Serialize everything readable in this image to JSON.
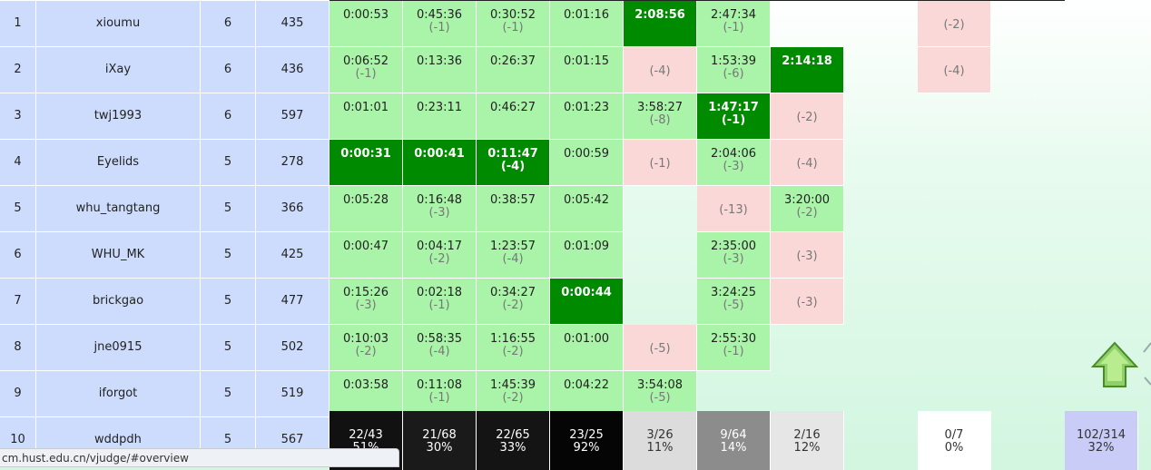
{
  "rows": [
    {
      "rank": "1",
      "name": "xioumu",
      "solved": "6",
      "penalty": "435",
      "cells": [
        {
          "s": "ac",
          "t": "0:00:53",
          "c": ""
        },
        {
          "s": "ac",
          "t": "0:45:36",
          "c": "(-1)"
        },
        {
          "s": "ac",
          "t": "0:30:52",
          "c": "(-1)"
        },
        {
          "s": "ac",
          "t": "0:01:16",
          "c": ""
        },
        {
          "s": "fb",
          "t": "2:08:56",
          "c": ""
        },
        {
          "s": "ac",
          "t": "2:47:34",
          "c": "(-1)"
        },
        {
          "s": "none",
          "t": "",
          "c": ""
        },
        {
          "s": "none",
          "t": "",
          "c": ""
        },
        {
          "s": "wa",
          "t": "",
          "c": "(-2)"
        }
      ]
    },
    {
      "rank": "2",
      "name": "iXay",
      "solved": "6",
      "penalty": "436",
      "cells": [
        {
          "s": "ac",
          "t": "0:06:52",
          "c": "(-1)"
        },
        {
          "s": "ac",
          "t": "0:13:36",
          "c": ""
        },
        {
          "s": "ac",
          "t": "0:26:37",
          "c": ""
        },
        {
          "s": "ac",
          "t": "0:01:15",
          "c": ""
        },
        {
          "s": "wa",
          "t": "",
          "c": "(-4)"
        },
        {
          "s": "ac",
          "t": "1:53:39",
          "c": "(-6)"
        },
        {
          "s": "fb",
          "t": "2:14:18",
          "c": ""
        },
        {
          "s": "none",
          "t": "",
          "c": ""
        },
        {
          "s": "wa",
          "t": "",
          "c": "(-4)"
        }
      ]
    },
    {
      "rank": "3",
      "name": "twj1993",
      "solved": "6",
      "penalty": "597",
      "cells": [
        {
          "s": "ac",
          "t": "0:01:01",
          "c": ""
        },
        {
          "s": "ac",
          "t": "0:23:11",
          "c": ""
        },
        {
          "s": "ac",
          "t": "0:46:27",
          "c": ""
        },
        {
          "s": "ac",
          "t": "0:01:23",
          "c": ""
        },
        {
          "s": "ac",
          "t": "3:58:27",
          "c": "(-8)"
        },
        {
          "s": "fb",
          "t": "1:47:17",
          "c": "(-1)"
        },
        {
          "s": "wa",
          "t": "",
          "c": "(-2)"
        },
        {
          "s": "none",
          "t": "",
          "c": ""
        },
        {
          "s": "none",
          "t": "",
          "c": ""
        }
      ]
    },
    {
      "rank": "4",
      "name": "Eyelids",
      "solved": "5",
      "penalty": "278",
      "cells": [
        {
          "s": "fb",
          "t": "0:00:31",
          "c": ""
        },
        {
          "s": "fb",
          "t": "0:00:41",
          "c": ""
        },
        {
          "s": "fb",
          "t": "0:11:47",
          "c": "(-4)"
        },
        {
          "s": "ac",
          "t": "0:00:59",
          "c": ""
        },
        {
          "s": "wa",
          "t": "",
          "c": "(-1)"
        },
        {
          "s": "ac",
          "t": "2:04:06",
          "c": "(-3)"
        },
        {
          "s": "wa",
          "t": "",
          "c": "(-4)"
        },
        {
          "s": "none",
          "t": "",
          "c": ""
        },
        {
          "s": "none",
          "t": "",
          "c": ""
        }
      ]
    },
    {
      "rank": "5",
      "name": "whu_tangtang",
      "solved": "5",
      "penalty": "366",
      "cells": [
        {
          "s": "ac",
          "t": "0:05:28",
          "c": ""
        },
        {
          "s": "ac",
          "t": "0:16:48",
          "c": "(-3)"
        },
        {
          "s": "ac",
          "t": "0:38:57",
          "c": ""
        },
        {
          "s": "ac",
          "t": "0:05:42",
          "c": ""
        },
        {
          "s": "none",
          "t": "",
          "c": ""
        },
        {
          "s": "wa",
          "t": "",
          "c": "(-13)"
        },
        {
          "s": "ac",
          "t": "3:20:00",
          "c": "(-2)"
        },
        {
          "s": "none",
          "t": "",
          "c": ""
        },
        {
          "s": "none",
          "t": "",
          "c": ""
        }
      ]
    },
    {
      "rank": "6",
      "name": "WHU_MK",
      "solved": "5",
      "penalty": "425",
      "cells": [
        {
          "s": "ac",
          "t": "0:00:47",
          "c": ""
        },
        {
          "s": "ac",
          "t": "0:04:17",
          "c": "(-2)"
        },
        {
          "s": "ac",
          "t": "1:23:57",
          "c": "(-4)"
        },
        {
          "s": "ac",
          "t": "0:01:09",
          "c": ""
        },
        {
          "s": "none",
          "t": "",
          "c": ""
        },
        {
          "s": "ac",
          "t": "2:35:00",
          "c": "(-3)"
        },
        {
          "s": "wa",
          "t": "",
          "c": "(-3)"
        },
        {
          "s": "none",
          "t": "",
          "c": ""
        },
        {
          "s": "none",
          "t": "",
          "c": ""
        }
      ]
    },
    {
      "rank": "7",
      "name": "brickgao",
      "solved": "5",
      "penalty": "477",
      "cells": [
        {
          "s": "ac",
          "t": "0:15:26",
          "c": "(-3)"
        },
        {
          "s": "ac",
          "t": "0:02:18",
          "c": "(-1)"
        },
        {
          "s": "ac",
          "t": "0:34:27",
          "c": "(-2)"
        },
        {
          "s": "fb",
          "t": "0:00:44",
          "c": ""
        },
        {
          "s": "none",
          "t": "",
          "c": ""
        },
        {
          "s": "ac",
          "t": "3:24:25",
          "c": "(-5)"
        },
        {
          "s": "wa",
          "t": "",
          "c": "(-3)"
        },
        {
          "s": "none",
          "t": "",
          "c": ""
        },
        {
          "s": "none",
          "t": "",
          "c": ""
        }
      ]
    },
    {
      "rank": "8",
      "name": "jne0915",
      "solved": "5",
      "penalty": "502",
      "cells": [
        {
          "s": "ac",
          "t": "0:10:03",
          "c": "(-2)"
        },
        {
          "s": "ac",
          "t": "0:58:35",
          "c": "(-4)"
        },
        {
          "s": "ac",
          "t": "1:16:55",
          "c": "(-2)"
        },
        {
          "s": "ac",
          "t": "0:01:00",
          "c": ""
        },
        {
          "s": "wa",
          "t": "",
          "c": "(-5)"
        },
        {
          "s": "ac",
          "t": "2:55:30",
          "c": "(-1)"
        },
        {
          "s": "none",
          "t": "",
          "c": ""
        },
        {
          "s": "none",
          "t": "",
          "c": ""
        },
        {
          "s": "none",
          "t": "",
          "c": ""
        }
      ]
    },
    {
      "rank": "9",
      "name": "iforgot",
      "solved": "5",
      "penalty": "519",
      "cells": [
        {
          "s": "ac",
          "t": "0:03:58",
          "c": ""
        },
        {
          "s": "ac",
          "t": "0:11:08",
          "c": "(-1)"
        },
        {
          "s": "ac",
          "t": "1:45:39",
          "c": "(-2)"
        },
        {
          "s": "ac",
          "t": "0:04:22",
          "c": ""
        },
        {
          "s": "ac",
          "t": "3:54:08",
          "c": "(-5)"
        },
        {
          "s": "none",
          "t": "",
          "c": ""
        },
        {
          "s": "none",
          "t": "",
          "c": ""
        },
        {
          "s": "none",
          "t": "",
          "c": ""
        },
        {
          "s": "none",
          "t": "",
          "c": ""
        }
      ]
    },
    {
      "rank": "10",
      "name": "wddpdh",
      "solved": "5",
      "penalty": "567",
      "cells": []
    }
  ],
  "stats": [
    {
      "ratio": "22/43",
      "pct": "51%",
      "bg": "#111111",
      "fg": "#ffffff"
    },
    {
      "ratio": "21/68",
      "pct": "30%",
      "bg": "#1a1a1a",
      "fg": "#ffffff"
    },
    {
      "ratio": "22/65",
      "pct": "33%",
      "bg": "#141414",
      "fg": "#ffffff"
    },
    {
      "ratio": "23/25",
      "pct": "92%",
      "bg": "#050505",
      "fg": "#ffffff"
    },
    {
      "ratio": "3/26",
      "pct": "11%",
      "bg": "#dcdcdc",
      "fg": "#333333"
    },
    {
      "ratio": "9/64",
      "pct": "14%",
      "bg": "#8c8c8c",
      "fg": "#ffffff"
    },
    {
      "ratio": "2/16",
      "pct": "12%",
      "bg": "#e6e6e6",
      "fg": "#333333"
    },
    {
      "ratio": "",
      "pct": "",
      "bg": "transparent",
      "fg": "#333333"
    },
    {
      "ratio": "0/7",
      "pct": "0%",
      "bg": "#ffffff",
      "fg": "#333333"
    },
    {
      "ratio": "",
      "pct": "",
      "bg": "transparent",
      "fg": "#333333"
    },
    {
      "ratio": "102/314",
      "pct": "32%",
      "bg": "#c9ccf7",
      "fg": "#333333"
    }
  ],
  "status_url": "cm.hust.edu.cn/vjudge/#overview",
  "icons": {
    "scroll_top": "up-arrow-icon",
    "edge": "partial-arrow-icon"
  },
  "colors": {
    "first_blood": "#008a00",
    "accepted": "#a9f4a9",
    "wrong": "#fbd8d8",
    "info": "#cddcfd"
  }
}
